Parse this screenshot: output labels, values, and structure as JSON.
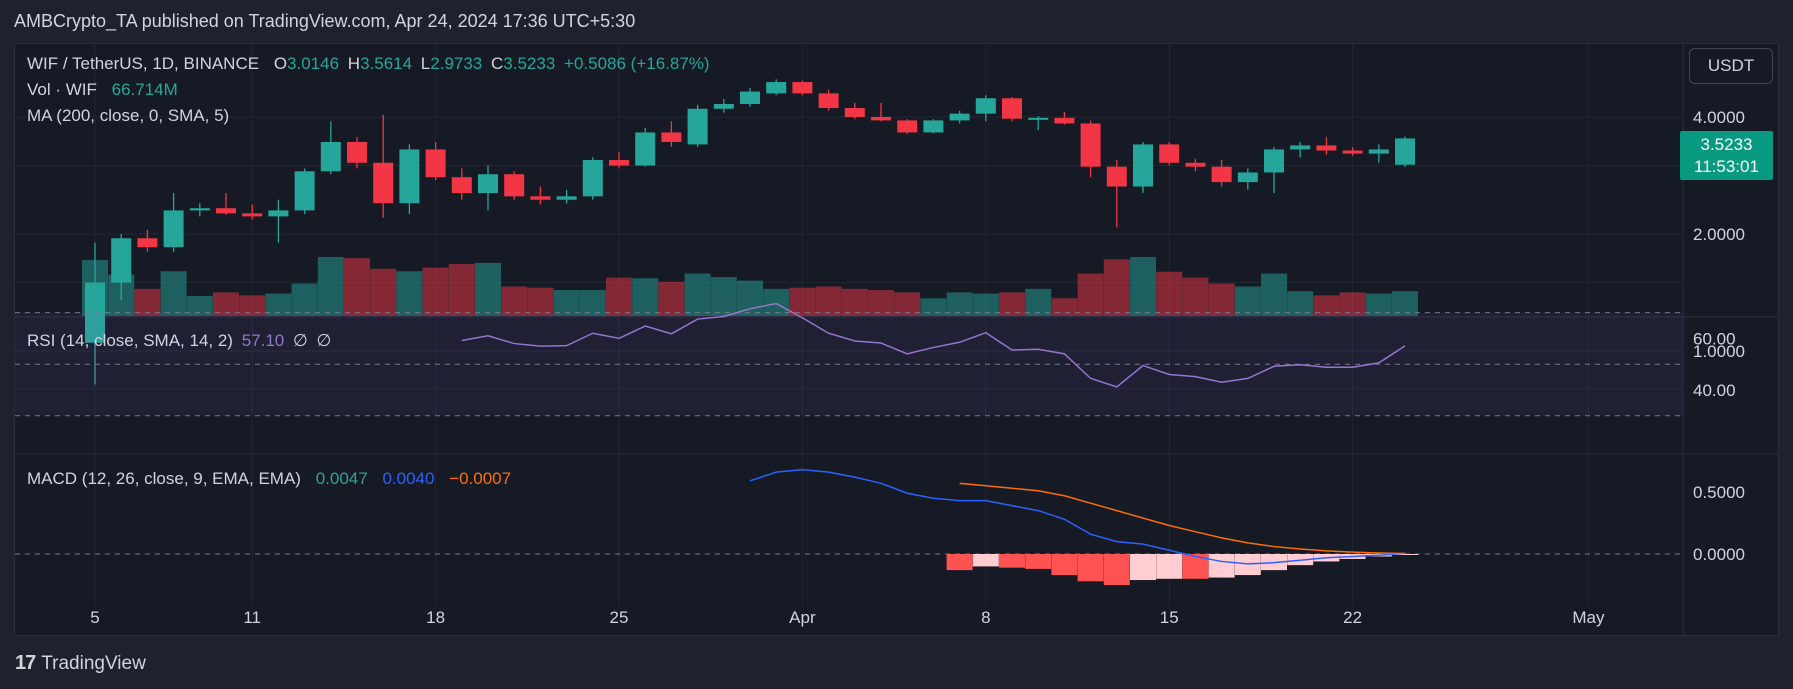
{
  "header": {
    "text": "AMBCrypto_TA published on TradingView.com, Apr 24, 2024 17:36 UTC+5:30"
  },
  "legend": {
    "symbol": "WIF / TetherUS, 1D, BINANCE",
    "o_label": "O",
    "o_val": "3.0146",
    "h_label": "H",
    "h_val": "3.5614",
    "l_label": "L",
    "l_val": "2.9733",
    "c_label": "C",
    "c_val": "3.5233",
    "change": "+0.5086 (+16.87%)",
    "vol_label": "Vol · WIF",
    "vol_val": "66.714M",
    "ma": "MA (200, close, 0, SMA, 5)",
    "rsi_label": "RSI (14, close, SMA, 14, 2)",
    "rsi_val": "57.10",
    "rsi_na1": "∅",
    "rsi_na2": "∅",
    "macd_label": "MACD (12, 26, close, 9, EMA, EMA)",
    "macd_val": "0.0047",
    "macd_signal": "0.0040",
    "macd_hist": "−0.0007"
  },
  "currency_button": "USDT",
  "price_tag": {
    "price": "3.5233",
    "countdown": "11:53:01"
  },
  "footer": {
    "logo": "17",
    "brand": "TradingView"
  },
  "colors": {
    "up": "#26a69a",
    "down": "#f23645",
    "rsi": "#9575cd",
    "macd": "#2962ff",
    "signal": "#ff6d00"
  },
  "chart_data": {
    "type": "candlestick",
    "price_axis": {
      "ticks": [
        "4.0000",
        "2.0000",
        "1.0000"
      ],
      "tick_values": [
        4,
        2,
        1
      ]
    },
    "rsi_axis": {
      "ticks": [
        "60.00",
        "40.00"
      ],
      "tick_values": [
        60,
        40
      ]
    },
    "macd_axis": {
      "ticks": [
        "0.5000",
        "0.0000"
      ],
      "tick_values": [
        0.5,
        0
      ]
    },
    "x_ticks": [
      {
        "label": "5",
        "index": 0
      },
      {
        "label": "11",
        "index": 6
      },
      {
        "label": "18",
        "index": 13
      },
      {
        "label": "25",
        "index": 20
      },
      {
        "label": "Apr",
        "index": 27
      },
      {
        "label": "8",
        "index": 34
      },
      {
        "label": "15",
        "index": 41
      },
      {
        "label": "22",
        "index": 48
      },
      {
        "label": "May",
        "index": 57
      }
    ],
    "candles": [
      {
        "date": "Mar 5",
        "o": 1.05,
        "h": 1.9,
        "l": 0.82,
        "c": 1.5
      },
      {
        "date": "Mar 6",
        "o": 1.5,
        "h": 2.0,
        "l": 1.35,
        "c": 1.95
      },
      {
        "date": "Mar 7",
        "o": 1.95,
        "h": 2.05,
        "l": 1.8,
        "c": 1.85
      },
      {
        "date": "Mar 8",
        "o": 1.85,
        "h": 2.55,
        "l": 1.8,
        "c": 2.3
      },
      {
        "date": "Mar 9",
        "o": 2.3,
        "h": 2.4,
        "l": 2.22,
        "c": 2.33
      },
      {
        "date": "Mar 10",
        "o": 2.33,
        "h": 2.55,
        "l": 2.24,
        "c": 2.26
      },
      {
        "date": "Mar 11",
        "o": 2.26,
        "h": 2.38,
        "l": 2.18,
        "c": 2.22
      },
      {
        "date": "Mar 12",
        "o": 2.22,
        "h": 2.45,
        "l": 1.9,
        "c": 2.3
      },
      {
        "date": "Mar 13",
        "o": 2.3,
        "h": 2.95,
        "l": 2.25,
        "c": 2.9
      },
      {
        "date": "Mar 14",
        "o": 2.9,
        "h": 3.9,
        "l": 2.85,
        "c": 3.45
      },
      {
        "date": "Mar 15",
        "o": 3.45,
        "h": 3.55,
        "l": 2.95,
        "c": 3.05
      },
      {
        "date": "Mar 16",
        "o": 3.05,
        "h": 4.05,
        "l": 2.2,
        "c": 2.4
      },
      {
        "date": "Mar 17",
        "o": 2.4,
        "h": 3.4,
        "l": 2.25,
        "c": 3.3
      },
      {
        "date": "Mar 18",
        "o": 3.3,
        "h": 3.45,
        "l": 2.75,
        "c": 2.8
      },
      {
        "date": "Mar 19",
        "o": 2.8,
        "h": 2.95,
        "l": 2.45,
        "c": 2.55
      },
      {
        "date": "Mar 20",
        "o": 2.55,
        "h": 3.0,
        "l": 2.3,
        "c": 2.85
      },
      {
        "date": "Mar 21",
        "o": 2.85,
        "h": 2.9,
        "l": 2.45,
        "c": 2.5
      },
      {
        "date": "Mar 22",
        "o": 2.5,
        "h": 2.65,
        "l": 2.38,
        "c": 2.45
      },
      {
        "date": "Mar 23",
        "o": 2.45,
        "h": 2.6,
        "l": 2.4,
        "c": 2.5
      },
      {
        "date": "Mar 24",
        "o": 2.5,
        "h": 3.15,
        "l": 2.45,
        "c": 3.1
      },
      {
        "date": "Mar 25",
        "o": 3.1,
        "h": 3.25,
        "l": 2.95,
        "c": 3.0
      },
      {
        "date": "Mar 26",
        "o": 3.0,
        "h": 3.75,
        "l": 2.98,
        "c": 3.65
      },
      {
        "date": "Mar 27",
        "o": 3.65,
        "h": 3.9,
        "l": 3.35,
        "c": 3.45
      },
      {
        "date": "Mar 28",
        "o": 3.4,
        "h": 4.3,
        "l": 3.35,
        "c": 4.2
      },
      {
        "date": "Mar 29",
        "o": 4.2,
        "h": 4.45,
        "l": 4.1,
        "c": 4.32
      },
      {
        "date": "Mar 30",
        "o": 4.32,
        "h": 4.75,
        "l": 4.25,
        "c": 4.65
      },
      {
        "date": "Mar 31",
        "o": 4.6,
        "h": 5.0,
        "l": 4.55,
        "c": 4.92
      },
      {
        "date": "Apr 1",
        "o": 4.92,
        "h": 4.96,
        "l": 4.55,
        "c": 4.6
      },
      {
        "date": "Apr 2",
        "o": 4.6,
        "h": 4.7,
        "l": 4.15,
        "c": 4.22
      },
      {
        "date": "Apr 3",
        "o": 4.22,
        "h": 4.35,
        "l": 3.95,
        "c": 4.0
      },
      {
        "date": "Apr 4",
        "o": 4.0,
        "h": 4.35,
        "l": 3.9,
        "c": 3.92
      },
      {
        "date": "Apr 5",
        "o": 3.92,
        "h": 3.95,
        "l": 3.62,
        "c": 3.65
      },
      {
        "date": "Apr 6",
        "o": 3.65,
        "h": 3.95,
        "l": 3.63,
        "c": 3.92
      },
      {
        "date": "Apr 7",
        "o": 3.92,
        "h": 4.15,
        "l": 3.85,
        "c": 4.08
      },
      {
        "date": "Apr 8",
        "o": 4.08,
        "h": 4.55,
        "l": 3.9,
        "c": 4.47
      },
      {
        "date": "Apr 9",
        "o": 4.47,
        "h": 4.5,
        "l": 3.9,
        "c": 3.96
      },
      {
        "date": "Apr 10",
        "o": 3.96,
        "h": 4.02,
        "l": 3.7,
        "c": 3.98
      },
      {
        "date": "Apr 11",
        "o": 3.98,
        "h": 4.12,
        "l": 3.82,
        "c": 3.85
      },
      {
        "date": "Apr 12",
        "o": 3.85,
        "h": 3.92,
        "l": 2.8,
        "c": 2.98
      },
      {
        "date": "Apr 13",
        "o": 2.98,
        "h": 3.1,
        "l": 2.08,
        "c": 2.65
      },
      {
        "date": "Apr 14",
        "o": 2.65,
        "h": 3.45,
        "l": 2.55,
        "c": 3.4
      },
      {
        "date": "Apr 15",
        "o": 3.4,
        "h": 3.45,
        "l": 3.0,
        "c": 3.05
      },
      {
        "date": "Apr 16",
        "o": 3.05,
        "h": 3.12,
        "l": 2.9,
        "c": 2.98
      },
      {
        "date": "Apr 17",
        "o": 2.98,
        "h": 3.1,
        "l": 2.65,
        "c": 2.72
      },
      {
        "date": "Apr 18",
        "o": 2.72,
        "h": 2.95,
        "l": 2.6,
        "c": 2.88
      },
      {
        "date": "Apr 19",
        "o": 2.88,
        "h": 3.35,
        "l": 2.55,
        "c": 3.3
      },
      {
        "date": "Apr 20",
        "o": 3.3,
        "h": 3.45,
        "l": 3.15,
        "c": 3.38
      },
      {
        "date": "Apr 21",
        "o": 3.38,
        "h": 3.55,
        "l": 3.2,
        "c": 3.28
      },
      {
        "date": "Apr 22",
        "o": 3.28,
        "h": 3.35,
        "l": 3.18,
        "c": 3.22
      },
      {
        "date": "Apr 23",
        "o": 3.22,
        "h": 3.4,
        "l": 3.05,
        "c": 3.3
      },
      {
        "date": "Apr 24",
        "o": 3.0146,
        "h": 3.5614,
        "l": 2.9733,
        "c": 3.5233
      }
    ],
    "volume_relative": [
      0.95,
      0.7,
      0.46,
      0.76,
      0.34,
      0.4,
      0.35,
      0.38,
      0.55,
      1.0,
      0.98,
      0.8,
      0.76,
      0.82,
      0.88,
      0.9,
      0.5,
      0.48,
      0.44,
      0.44,
      0.65,
      0.64,
      0.58,
      0.72,
      0.66,
      0.6,
      0.46,
      0.48,
      0.5,
      0.46,
      0.44,
      0.4,
      0.3,
      0.4,
      0.38,
      0.4,
      0.46,
      0.3,
      0.72,
      0.96,
      1.0,
      0.75,
      0.65,
      0.55,
      0.5,
      0.72,
      0.42,
      0.35,
      0.4,
      0.38,
      0.42
    ],
    "rsi": [
      null,
      null,
      null,
      null,
      null,
      null,
      null,
      null,
      null,
      null,
      null,
      null,
      null,
      null,
      59.2,
      61.0,
      58.0,
      57.0,
      57.2,
      62.0,
      60.0,
      64.8,
      61.8,
      67.5,
      68.5,
      71.5,
      73.5,
      68.0,
      62.0,
      59.0,
      58.2,
      54.0,
      56.5,
      58.5,
      62.2,
      55.5,
      55.8,
      54.0,
      44.5,
      41.2,
      49.5,
      46.0,
      45.2,
      43.0,
      44.5,
      49.2,
      49.8,
      48.8,
      48.8,
      50.5,
      57.1
    ],
    "macd_line": [
      null,
      null,
      null,
      null,
      null,
      null,
      null,
      null,
      null,
      null,
      null,
      null,
      null,
      null,
      null,
      null,
      null,
      null,
      null,
      null,
      null,
      null,
      null,
      null,
      null,
      0.59,
      0.66,
      0.68,
      0.66,
      0.62,
      0.57,
      0.49,
      0.45,
      0.43,
      0.43,
      0.39,
      0.35,
      0.28,
      0.16,
      0.1,
      0.08,
      0.03,
      -0.02,
      -0.06,
      -0.08,
      -0.07,
      -0.05,
      -0.03,
      -0.02,
      -0.01,
      0.0047
    ],
    "signal_line": [
      null,
      null,
      null,
      null,
      null,
      null,
      null,
      null,
      null,
      null,
      null,
      null,
      null,
      null,
      null,
      null,
      null,
      null,
      null,
      null,
      null,
      null,
      null,
      null,
      null,
      null,
      null,
      null,
      null,
      null,
      null,
      null,
      null,
      0.57,
      0.55,
      0.53,
      0.51,
      0.47,
      0.41,
      0.35,
      0.29,
      0.23,
      0.18,
      0.13,
      0.09,
      0.06,
      0.04,
      0.025,
      0.015,
      0.008,
      0.004
    ],
    "macd_hist": [
      null,
      null,
      null,
      null,
      null,
      null,
      null,
      null,
      null,
      null,
      null,
      null,
      null,
      null,
      null,
      null,
      null,
      null,
      null,
      null,
      null,
      null,
      null,
      null,
      null,
      null,
      null,
      null,
      null,
      null,
      null,
      null,
      null,
      -0.13,
      -0.1,
      -0.11,
      -0.12,
      -0.17,
      -0.22,
      -0.25,
      -0.21,
      -0.2,
      -0.2,
      -0.19,
      -0.17,
      -0.13,
      -0.09,
      -0.06,
      -0.04,
      -0.02,
      -0.0007
    ]
  }
}
